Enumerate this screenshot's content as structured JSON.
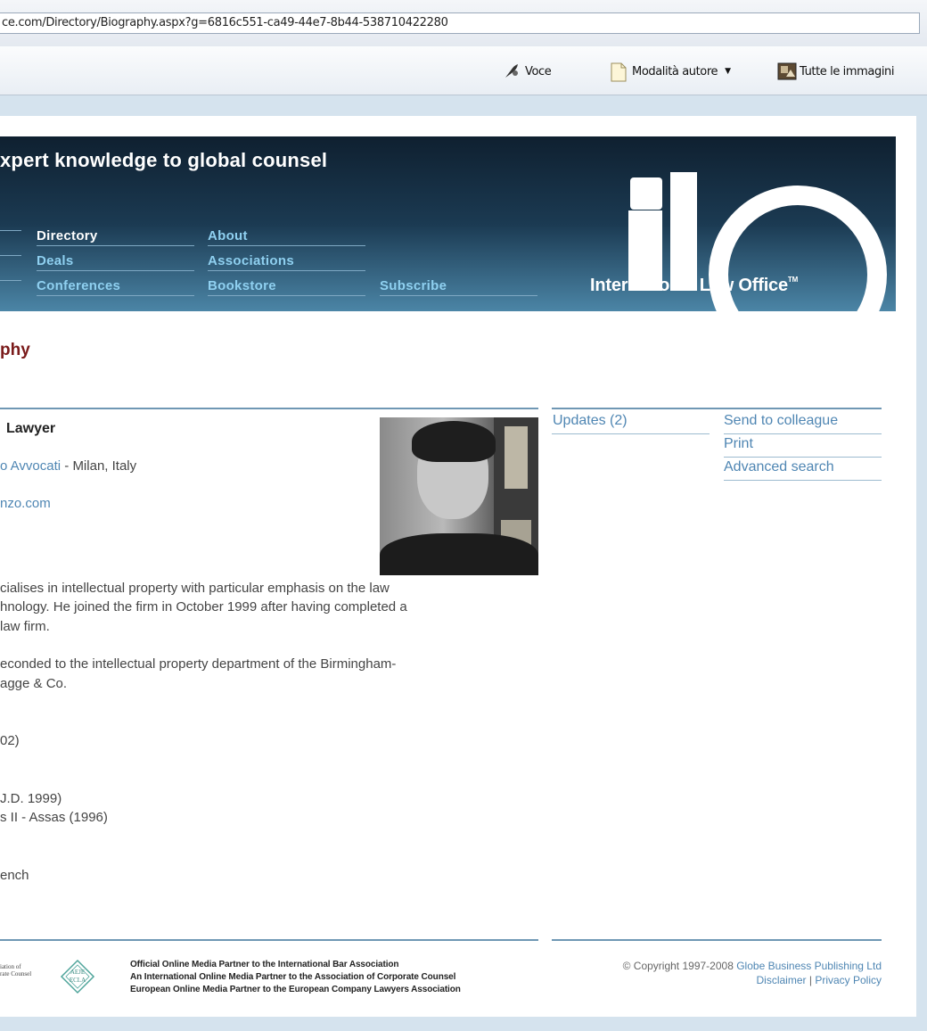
{
  "browser": {
    "url": "ce.com/Directory/Biography.aspx?g=6816c551-ca49-44e7-8b44-538710422280",
    "commands": {
      "voice": "Voce",
      "author_mode": "Modalità autore",
      "all_images": "Tutte le immagini"
    }
  },
  "banner": {
    "tagline": "xpert knowledge to global counsel",
    "nav": {
      "directory": "Directory",
      "deals": "Deals",
      "conferences": "Conferences",
      "about": "About",
      "associations": "Associations",
      "bookstore": "Bookstore",
      "subscribe": "Subscribe"
    },
    "logo_text": "International Law Office",
    "logo_tm": "TM"
  },
  "page": {
    "heading": "phy",
    "lawyer_heading": "Lawyer",
    "firm_name": "o Avvocati",
    "firm_location": " - Milan, Italy",
    "email": "nzo.com",
    "paragraphs": [
      "cialises in intellectual property with particular emphasis on the law",
      "hnology. He joined the firm in October 1999 after having completed a",
      " law firm.",
      "econded to the intellectual property department of the Birmingham-",
      "agge & Co.",
      "02)",
      "J.D. 1999)",
      "s II - Assas (1996)",
      "ench"
    ]
  },
  "sidebar": {
    "updates": "Updates (2)",
    "send_to_colleague": "Send to colleague",
    "print": "Print",
    "advanced_search": "Advanced search"
  },
  "footer": {
    "acc_logo_line1": "iation of",
    "acc_logo_line2": "rate Counsel",
    "badge_line1": "AEJE",
    "badge_line2": "ECLA",
    "partner_lines": [
      "Official Online Media Partner to the International Bar Association",
      "An International Online Media Partner to the Association of Corporate Counsel",
      "European Online Media Partner to the European Company Lawyers Association"
    ],
    "copyright": "© Copyright 1997-2008",
    "publisher": "Globe Business Publishing Ltd",
    "disclaimer": "Disclaimer",
    "separator": "|",
    "privacy": "Privacy Policy"
  }
}
